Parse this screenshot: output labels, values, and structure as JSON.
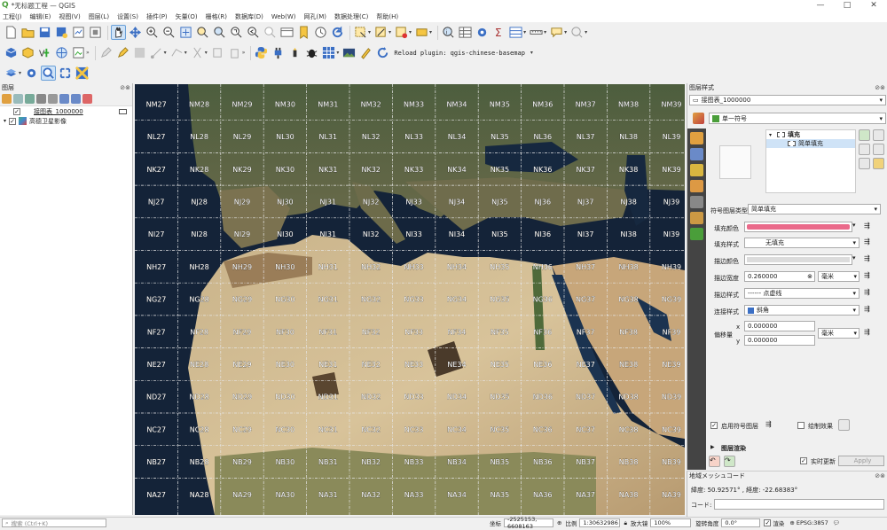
{
  "window": {
    "title": "*无标题工程 — QGIS",
    "logo": "Q"
  },
  "menu": [
    "工程(J)",
    "编辑(E)",
    "视图(V)",
    "图层(L)",
    "设置(S)",
    "插件(P)",
    "矢量(O)",
    "栅格(R)",
    "数据库(D)",
    "Web(W)",
    "网孔(M)",
    "数据处理(C)",
    "帮助(H)"
  ],
  "toolbar": {
    "reload_plugin_label": "Reload plugin: qgis-chinese-basemap"
  },
  "layers_panel": {
    "title": "图层",
    "layers": [
      {
        "name": "接图表_1000000",
        "checked": true
      },
      {
        "name": "高德卫星影像",
        "checked": true
      }
    ]
  },
  "grid": {
    "rows": [
      "NM",
      "NL",
      "NK",
      "NJ",
      "NI",
      "NH",
      "NG",
      "NF",
      "NE",
      "ND",
      "NC",
      "NB",
      "NA"
    ],
    "cols": [
      "27",
      "28",
      "29",
      "30",
      "31",
      "32",
      "33",
      "34",
      "35",
      "36",
      "37",
      "38",
      "39"
    ]
  },
  "style_panel": {
    "title": "图层样式",
    "layer_select": "接图表_1000000",
    "renderer": "单一符号",
    "tree_fill": "填充",
    "tree_simple_fill": "简单填充",
    "symbol_layer_type_label": "符号图层类型",
    "symbol_layer_type_value": "简单填充",
    "props": [
      {
        "label": "填充颜色",
        "value": ""
      },
      {
        "label": "填充样式",
        "value": "无填充"
      },
      {
        "label": "描边颜色",
        "value": ""
      },
      {
        "label": "描边宽度",
        "value": "0.260000"
      },
      {
        "label": "描边样式",
        "value": "------ 点虚线"
      },
      {
        "label": "连接样式",
        "value": "斜角"
      }
    ],
    "stroke_unit": "毫米",
    "offset_label": "偏移量",
    "offset_x_label": "x",
    "offset_x": "0.000000",
    "offset_y_label": "y",
    "offset_y": "0.000000",
    "offset_unit": "毫米",
    "enable_layer_label": "启用符号图层",
    "draw_effects_label": "绘制效果",
    "layer_rendering": "图层渲染",
    "live_update": "实时更新",
    "apply": "Apply",
    "fill_color": "#ea6a8a"
  },
  "mesh_panel": {
    "title": "地域メッシュコード",
    "coords": "緯度: 50.92571° , 経度: -22.68383°",
    "code_label": "コード:"
  },
  "statusbar": {
    "search_placeholder": "搜索 (Ctrl+K)",
    "coord_label": "坐标",
    "coord_value": "-2525153, 6608163",
    "scale_label": "比例",
    "scale_value": "1:30632986",
    "magnifier_label": "放大镜",
    "magnifier_value": "100%",
    "rotation_label": "旋转角度",
    "rotation_value": "0.0°",
    "render_label": "渲染",
    "crs": "EPSG:3857"
  }
}
